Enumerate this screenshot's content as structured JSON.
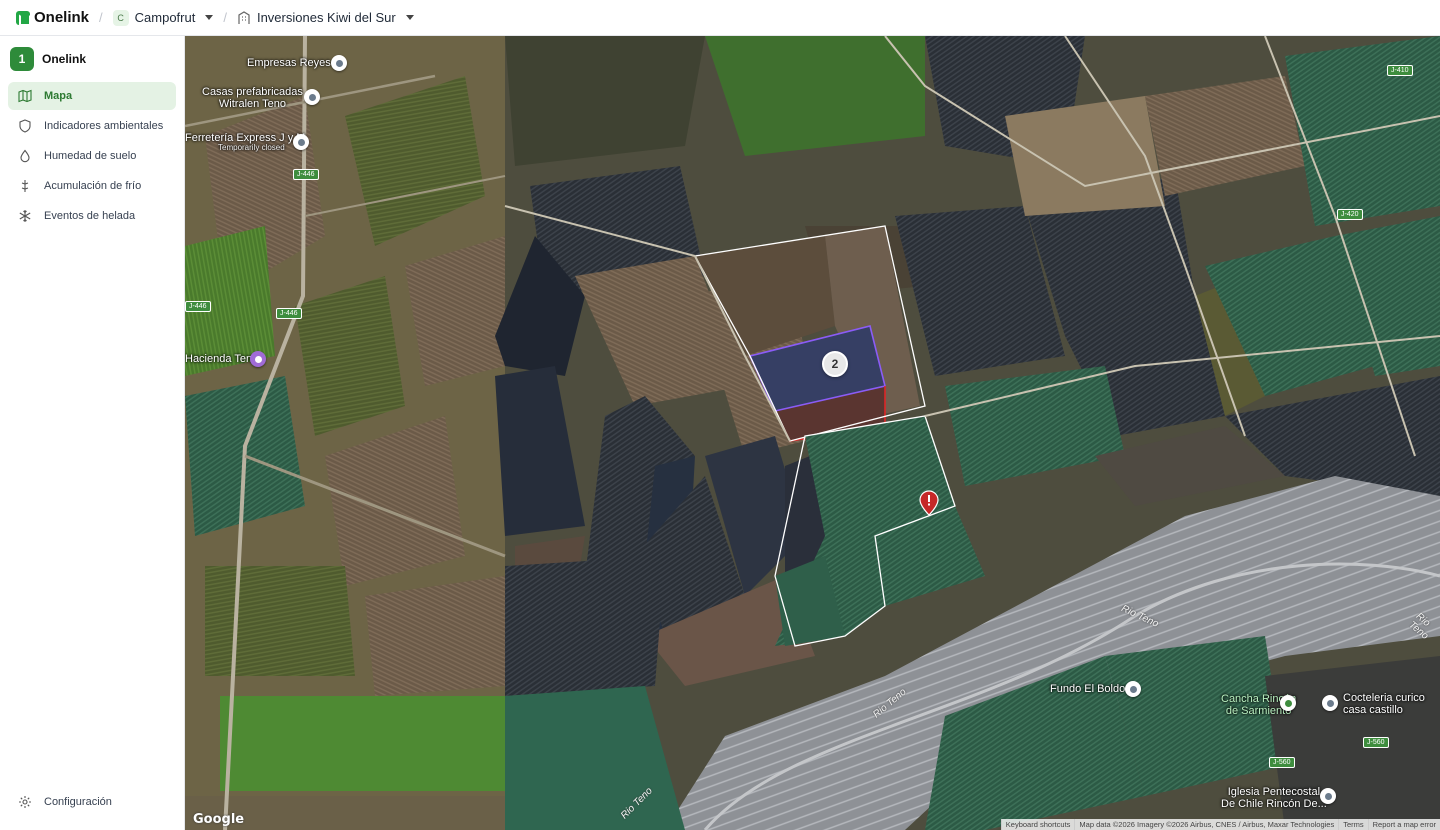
{
  "topbar": {
    "app_name": "Onelink",
    "separator": "/",
    "company": {
      "initial": "C",
      "name": "Campofrut"
    },
    "farm": {
      "name": "Inversiones Kiwi del Sur"
    }
  },
  "sidebar": {
    "org": {
      "badge": "1",
      "name": "Onelink"
    },
    "items": [
      {
        "label": "Mapa",
        "icon": "map-icon",
        "active": true
      },
      {
        "label": "Indicadores ambientales",
        "icon": "shield-icon",
        "active": false
      },
      {
        "label": "Humedad de suelo",
        "icon": "drop-icon",
        "active": false
      },
      {
        "label": "Acumulación de frío",
        "icon": "thermometer-icon",
        "active": false
      },
      {
        "label": "Eventos de helada",
        "icon": "snowflake-icon",
        "active": false
      }
    ],
    "settings_label": "Configuración"
  },
  "map": {
    "places": {
      "empresas_reyes": "Empresas Reyes",
      "casas_prefabricadas": "Casas prefabricadas\nWitralen Teno",
      "ferreteria": "Ferretería Express J y M",
      "ferreteria_status": "Temporarily closed",
      "hacienda": "Hacienda Teno",
      "fundo": "Fundo El Boldo",
      "cancha": "Cancha Rincón\nde Sarmiento",
      "cocteleria": "Cocteleria curico\ncasa castillo",
      "iglesia": "Iglesia Pentecostal\nDe Chile Rincón De..."
    },
    "rivers": [
      "Rio Teno",
      "Rio Teno",
      "Rio Teno",
      "Rio Teno"
    ],
    "roads": [
      "J-446",
      "J-446",
      "J-446",
      "J-410",
      "J-420",
      "J-560",
      "J-560"
    ],
    "cluster_count": "2",
    "alert_icon": "warning-pin-icon",
    "google_logo": "Google",
    "attribution": {
      "shortcuts": "Keyboard shortcuts",
      "data": "Map data ©2026 Imagery ©2026 Airbus, CNES / Airbus, Maxar Technologies",
      "terms": "Terms",
      "report": "Report a map error"
    },
    "colors": {
      "selected_outline": "#8b5cf6",
      "alert_outline": "#dc2626",
      "field_outline": "#ffffff",
      "brand": "#2e8b3a"
    }
  }
}
